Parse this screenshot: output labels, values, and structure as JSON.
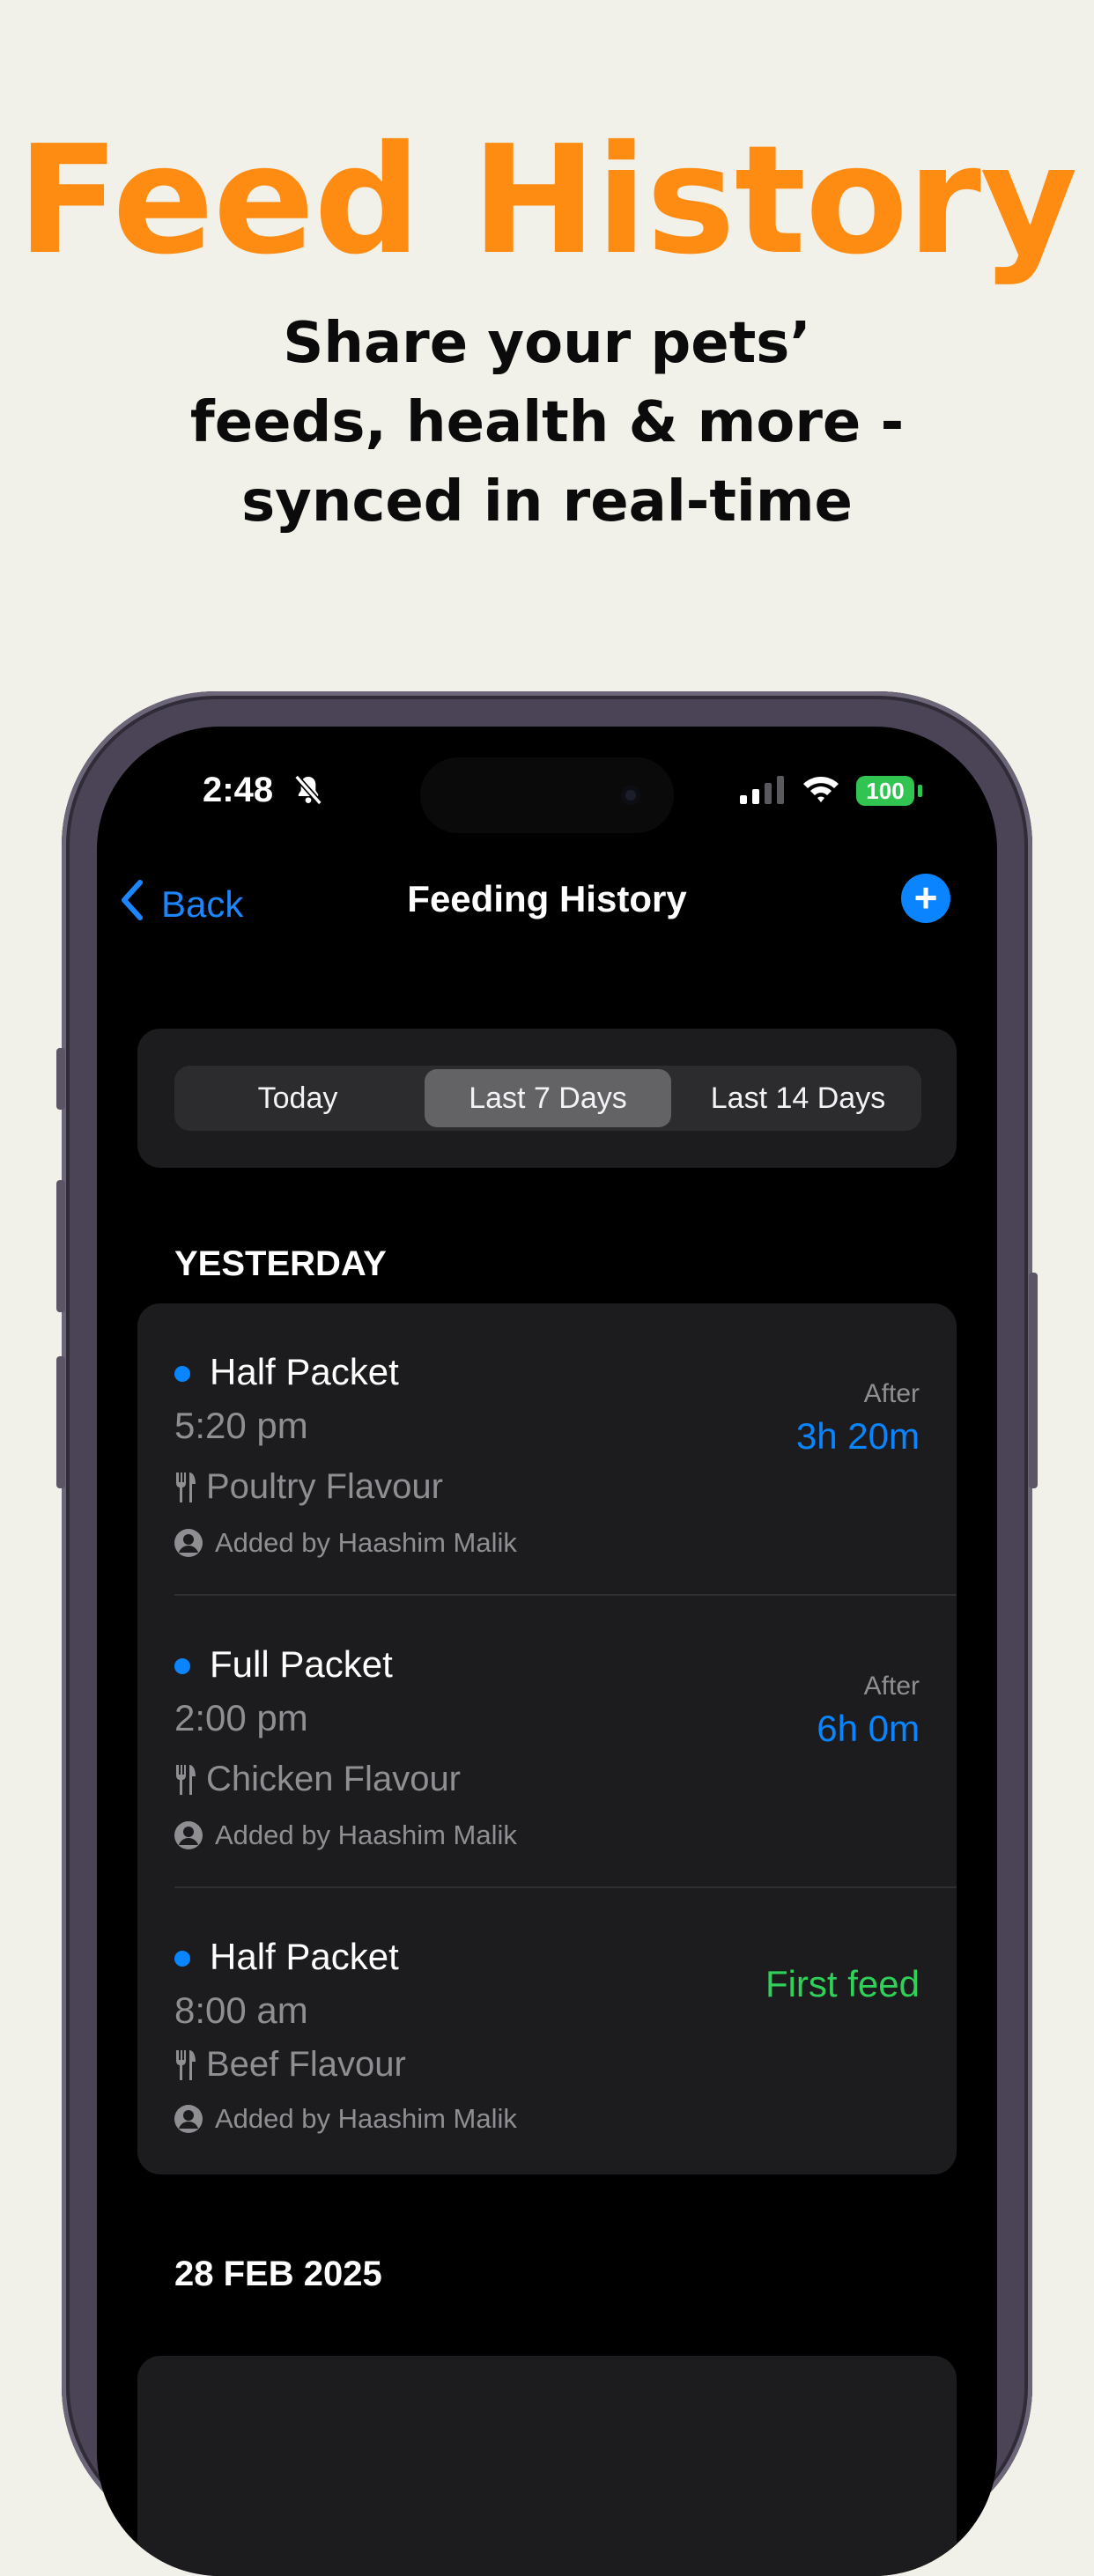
{
  "headline": "Feed History",
  "subheadline": "Share your pets’ feeds, health & more - synced in real-time",
  "status_bar": {
    "time": "2:48",
    "battery": "100"
  },
  "nav": {
    "back_label": "Back",
    "title": "Feeding History",
    "add_icon": "plus-circle-icon"
  },
  "segments": {
    "today": "Today",
    "last7": "Last 7 Days",
    "last14": "Last 14 Days",
    "selected": "Last 7 Days"
  },
  "sections": [
    {
      "title": "YESTERDAY",
      "entries": [
        {
          "quantity": "Half Packet",
          "time": "5:20 pm",
          "flavour": "Poultry Flavour",
          "added_by": "Added by Haashim Malik",
          "after_label": "After",
          "after_value": "3h 20m"
        },
        {
          "quantity": "Full Packet",
          "time": "2:00 pm",
          "flavour": "Chicken Flavour",
          "added_by": "Added by Haashim Malik",
          "after_label": "After",
          "after_value": "6h 0m"
        },
        {
          "quantity": "Half Packet",
          "time": "8:00 am",
          "flavour": "Beef Flavour",
          "added_by": "Added by Haashim Malik",
          "status": "First feed"
        }
      ]
    },
    {
      "title": "28 FEB 2025"
    }
  ],
  "colors": {
    "accent_orange": "#ff8c12",
    "ios_blue": "#0a84ff",
    "ios_green": "#30d158",
    "background": "#f2f1e9"
  }
}
